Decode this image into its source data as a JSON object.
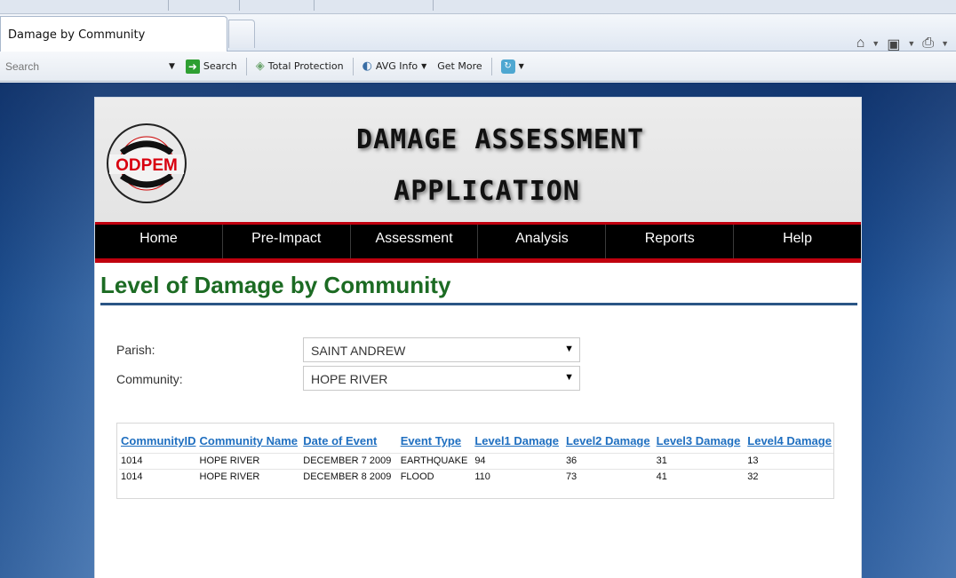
{
  "browser": {
    "tab_title": "Damage by Community",
    "search_placeholder": "Search",
    "search_button": "Search",
    "toolbar_items": [
      "Total Protection",
      "AVG Info",
      "Get More"
    ]
  },
  "app": {
    "logo_text": "ODPEM",
    "title_line1": "DAMAGE ASSESSMENT",
    "title_line2": "APPLICATION",
    "menu": [
      "Home",
      "Pre-Impact",
      "Assessment",
      "Analysis",
      "Reports",
      "Help"
    ],
    "page_title": "Level of Damage by Community"
  },
  "form": {
    "parish_label": "Parish:",
    "parish_value": "SAINT ANDREW",
    "community_label": "Community:",
    "community_value": "HOPE RIVER"
  },
  "table": {
    "headers": [
      "CommunityID",
      "Community Name",
      "Date of Event",
      "Event Type",
      "Level1 Damage",
      "Level2 Damage",
      "Level3 Damage",
      "Level4 Damage"
    ],
    "rows": [
      [
        "1014",
        "HOPE RIVER",
        "DECEMBER 7 2009",
        "EARTHQUAKE",
        "94",
        "36",
        "31",
        "13"
      ],
      [
        "1014",
        "HOPE RIVER",
        "DECEMBER 8 2009",
        "FLOOD",
        "110",
        "73",
        "41",
        "32"
      ]
    ]
  },
  "colors": {
    "title_green": "#1c6b23",
    "link_blue": "#1f6fc0",
    "menu_red": "#c0000e",
    "background_blue": "#2d62a2"
  }
}
